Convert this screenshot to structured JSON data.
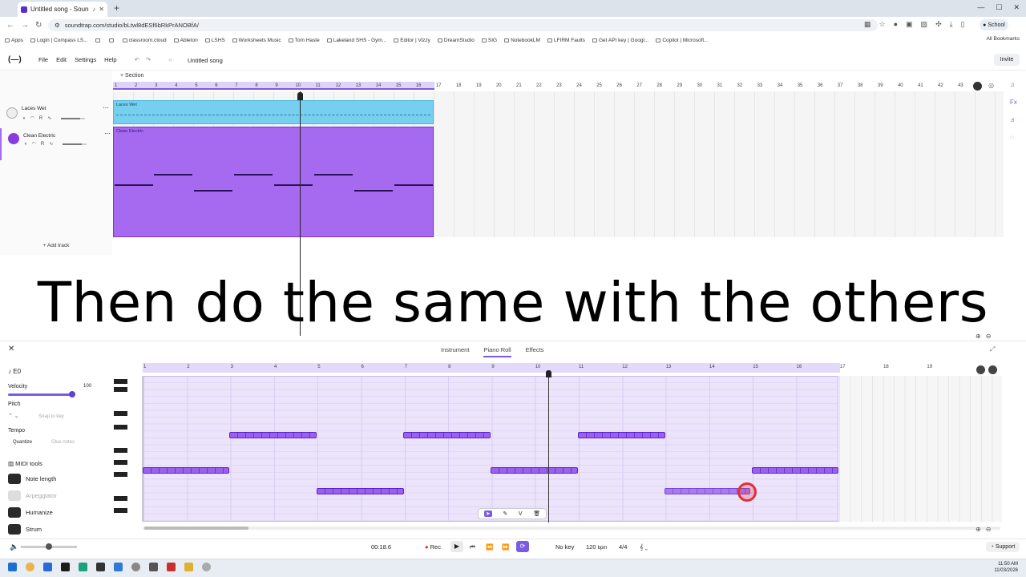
{
  "browser": {
    "tab_title": "Untitled song - Soundtrap",
    "url": "soundtrap.com/studio/bLtwl8dESf6bRkPrANOBfA/",
    "profile": "School",
    "bookmarks": [
      "Apps",
      "Login | Compass LS...",
      "",
      "",
      "classroom.cloud",
      "Ableton",
      "LSHS",
      "Worksheets Music",
      "Tom Haste",
      "Lakeland SHS - Gym...",
      "Editor | Vizzy",
      "DreamStudio",
      "SIG",
      "NotebookLM",
      "LFIRM Faults",
      "Get API key | Googl...",
      "Copilot | Microsoft..."
    ],
    "all_bookmarks": "All Bookmarks"
  },
  "app": {
    "logo": "(—)",
    "menu": [
      "File",
      "Edit",
      "Settings",
      "Help"
    ],
    "song_title": "Untitled song",
    "invite": "Invite",
    "section": "+ Section",
    "add_track": "+ Add track"
  },
  "ruler_numbers": [
    "1",
    "2",
    "3",
    "4",
    "5",
    "6",
    "7",
    "8",
    "9",
    "10",
    "11",
    "12",
    "13",
    "14",
    "15",
    "16",
    "17",
    "18",
    "19",
    "20",
    "21",
    "22",
    "23",
    "24",
    "25",
    "26",
    "27",
    "28",
    "29",
    "30",
    "31",
    "32",
    "33",
    "34",
    "35",
    "36",
    "37",
    "38",
    "39",
    "40",
    "41",
    "42",
    "43"
  ],
  "tracks": [
    {
      "name": "Laces Wet",
      "clip_label": "Laces Wet",
      "color": "#77cff0",
      "icon_color": "#444"
    },
    {
      "name": "Clean Electric",
      "clip_label": "Clean Electric",
      "color": "#a66af0",
      "icon_color": "#8a3ce0"
    }
  ],
  "caption": "Then do the same with the others",
  "piano_roll": {
    "tabs": [
      "Instrument",
      "Piano Roll",
      "Effects"
    ],
    "active_tab": "Piano Roll",
    "note_name": "E0",
    "velocity_label": "Velocity",
    "velocity_value": "100",
    "pitch_label": "Pitch",
    "snap_to_key": "Snap to key",
    "tempo_label": "Tempo",
    "quantize": "Quantize",
    "glue_notes": "Glue notes",
    "midi_tools": "MIDI tools",
    "tools": [
      "Note length",
      "Arpeggiator",
      "Humanize",
      "Strum"
    ],
    "ruler_numbers": [
      "1",
      "2",
      "3",
      "4",
      "5",
      "6",
      "7",
      "8",
      "9",
      "10",
      "11",
      "12",
      "13",
      "14",
      "15",
      "16",
      "17",
      "18",
      "19"
    ]
  },
  "transport": {
    "time": "00:18.6",
    "rec": "Rec",
    "key": "No key",
    "tempo": "120",
    "tempo_unit": "bpm",
    "meter": "4/4",
    "support": "Support"
  },
  "clock": {
    "time": "11:50 AM",
    "date": "11/03/2026"
  }
}
